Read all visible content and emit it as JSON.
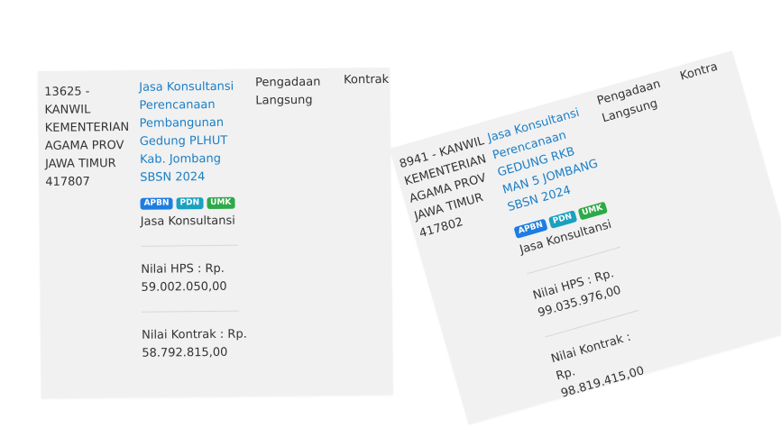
{
  "cards": [
    {
      "id_text": "13625 - KANWIL KEMENTERIAN AGAMA PROV JAWA TIMUR 417807",
      "id_lines": [
        "13625 -",
        "KANWIL",
        "KEMENTERIAN",
        "AGAMA PROV",
        "JAWA TIMUR",
        "417807"
      ],
      "title_lines": [
        "Jasa Konsultansi",
        "Perencanaan",
        "Pembangunan",
        "Gedung PLHUT",
        "Kab. Jombang",
        "SBSN 2024"
      ],
      "badges": [
        "APBN",
        "PDN",
        "UMK"
      ],
      "category": "Jasa Konsultansi",
      "hps_label": "Nilai HPS : Rp.",
      "hps_value": "59.002.050,00",
      "kontrak_label": "Nilai Kontrak : Rp.",
      "kontrak_value": "58.792.815,00",
      "method_lines": [
        "Pengadaan",
        "Langsung"
      ],
      "contract_col": "Kontrak"
    },
    {
      "id_lines": [
        "8941 - KANWIL",
        "KEMENTERIAN",
        "AGAMA PROV",
        "JAWA TIMUR",
        "417802"
      ],
      "title_lines": [
        "Jasa Konsultansi",
        "Perencanaan",
        "GEDUNG RKB",
        "MAN 5 JOMBANG",
        "SBSN 2024"
      ],
      "badges": [
        "APBN",
        "PDN",
        "UMK"
      ],
      "category": "Jasa Konsultansi",
      "hps_label": "Nilai HPS : Rp.",
      "hps_value": "99.035.976,00",
      "kontrak_label": "Nilai Kontrak :",
      "kontrak_value": "Rp. 98.819.415,00",
      "method_lines": [
        "Pengadaan",
        "Langsung"
      ],
      "contract_col": "Kontra"
    }
  ],
  "colors": {
    "link": "#1a7fc7",
    "apbn": "#1e7de0",
    "pdn": "#1aa1c0",
    "umk": "#2daa48"
  }
}
